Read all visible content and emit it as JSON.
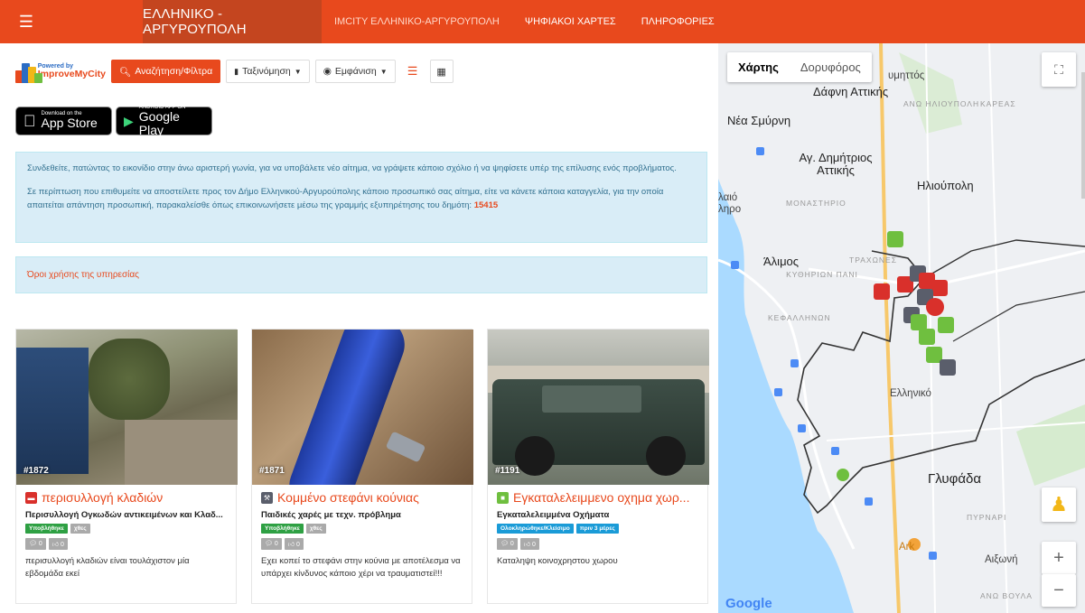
{
  "header": {
    "brand": "ΕΛΛΗΝΙΚΟ - ΑΡΓΥΡΟΥΠΟΛΗ",
    "nav": [
      "IMCITY ΕΛΛΗΝΙΚΟ-ΑΡΓΥΡΟΥΠΟΛΗ",
      "ΨΗΦΙΑΚΟΙ ΧΑΡΤΕΣ",
      "ΠΛΗΡΟΦΟΡΙΕΣ"
    ]
  },
  "logo": {
    "line1": "Powered by",
    "line2": "ImproveMyCity"
  },
  "toolbar": {
    "search_label": "Αναζήτηση/Φίλτρα",
    "sort_label": "Ταξινόμηση",
    "view_label": "Εμφάνιση"
  },
  "stores": {
    "apple_small": "Download on the",
    "apple_big": "App Store",
    "google_small": "ANDROID APP ON",
    "google_big": "Google Play"
  },
  "info": {
    "p1": "Συνδεθείτε, πατώντας το εικονίδιο στην άνω αριστερή γωνία, για να υποβάλετε νέο αίτημα, να γράψετε κάποιο σχόλιο ή να ψηφίσετε υπέρ της επίλυσης ενός προβλήματος.",
    "p2": "Σε περίπτωση που επιθυμείτε να αποστείλετε προς τον Δήμο Ελληνικού-Αργυρούπολης κάποιο προσωπικό σας αίτημα, είτε να κάνετε κάποια καταγγελία, για την οποία απαιτείται απάντηση προσωπική, παρακαλείσθε όπως επικοινωνήσετε μέσω της γραμμής εξυπηρέτησης του δημότη:",
    "phone": "15415"
  },
  "terms": "Όροι χρήσης της υπηρεσίας",
  "cards": [
    {
      "id": "#1872",
      "title": "περισυλλογή κλαδιών",
      "category": "Περισυλλογή Ογκωδών αντικειμένων και Κλαδ...",
      "status": "Υποβλήθηκε",
      "status_color": "#2ea043",
      "time": "χθες",
      "time_color": "#aaa",
      "comments": "0",
      "votes": "0",
      "description": "περισυλλογή κλαδιών είναι τουλάχιστον μία εβδομάδα εκεί",
      "icon_color": "#d9302b"
    },
    {
      "id": "#1871",
      "title": "Κομμένο στεφάνι κούνιας",
      "category": "Παιδικές χαρές με τεχν. πρόβλημα",
      "status": "Υποβλήθηκε",
      "status_color": "#2ea043",
      "time": "χθες",
      "time_color": "#aaa",
      "comments": "0",
      "votes": "0",
      "description": "Εχει κοπεί το στεφάνι στην κούνια με αποτέλεσμα να υπάρχει κίνδυνος κάποιο χέρι να τραυματιστεί!!!",
      "icon_color": "#5a5e6b"
    },
    {
      "id": "#1191",
      "title": "Εγκαταλελειμμενο οχημα χωρ...",
      "category": "Εγκαταλελειμμένα Οχήματα",
      "status": "Ολοκληρώθηκε/Κλείσιμο",
      "status_color": "#1a9bd7",
      "time": "πριν 3 μέρες",
      "time_color": "#1a9bd7",
      "comments": "0",
      "votes": "0",
      "description": "Καταληψη κοινοχρηστου χωρου",
      "icon_color": "#6fbf3f"
    }
  ],
  "map": {
    "tab_map": "Χάρτης",
    "tab_sat": "Δορυφόρος",
    "labels": [
      "υμηττός",
      "Δάφνη Αττικής",
      "ΑΝΩ ΗΛΙΟΥΠΟΛΗ",
      "ΚΑΡΕΑΣ",
      "Νέα Σμύρνη",
      "Αγ. Δημήτριος Αττικής",
      "Ηλιούπολη",
      "λαιό ληρο",
      "ΜΟΝΑΣΤΗΡΙΟ",
      "Άλιμος",
      "ΚΥΘΗΡΙΩΝ ΠΑΝΙ",
      "ΤΡΑΧΩΝΕΣ",
      "ΚΕΦΑΛΛΗΝΩΝ",
      "Ελληνικό",
      "Γλυφάδα",
      "ΠΥΡΝΑΡΙ",
      "Αιξωνή",
      "ΑΝΩ ΒΟΥΛΑ",
      "Ark"
    ],
    "google": "Google"
  }
}
